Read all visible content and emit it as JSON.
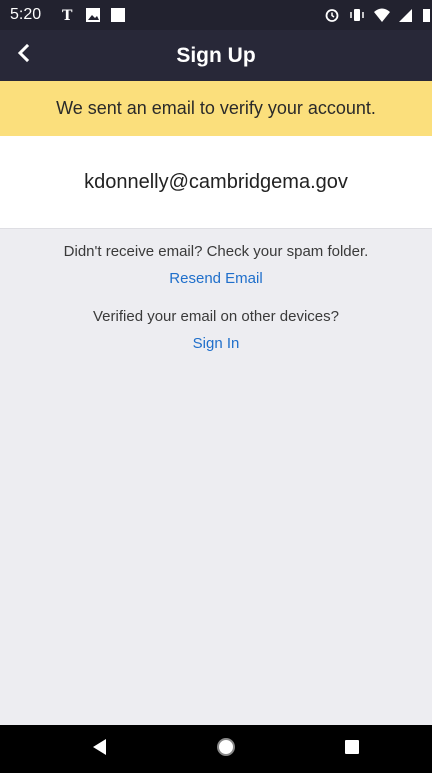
{
  "status_bar": {
    "time": "5:20",
    "left_icons": [
      "nytimes-icon",
      "image-icon",
      "square-icon"
    ],
    "right_icons": [
      "alarm-icon",
      "vibrate-icon",
      "wifi-icon",
      "signal-icon",
      "battery-icon"
    ]
  },
  "app_bar": {
    "title": "Sign Up",
    "back_icon": "chevron-left-icon"
  },
  "notice": {
    "text": "We sent an email to verify your account."
  },
  "email": {
    "address": "kdonnelly@cambridgema.gov"
  },
  "resend": {
    "message": "Didn't receive email? Check your spam folder.",
    "link": "Resend Email"
  },
  "signin": {
    "message": "Verified your email on other devices?",
    "link": "Sign In"
  },
  "colors": {
    "status_bar": "#22222f",
    "app_bar": "#282838",
    "banner": "#fbdf7c",
    "link": "#1f6fcb",
    "background": "#ededf1"
  }
}
